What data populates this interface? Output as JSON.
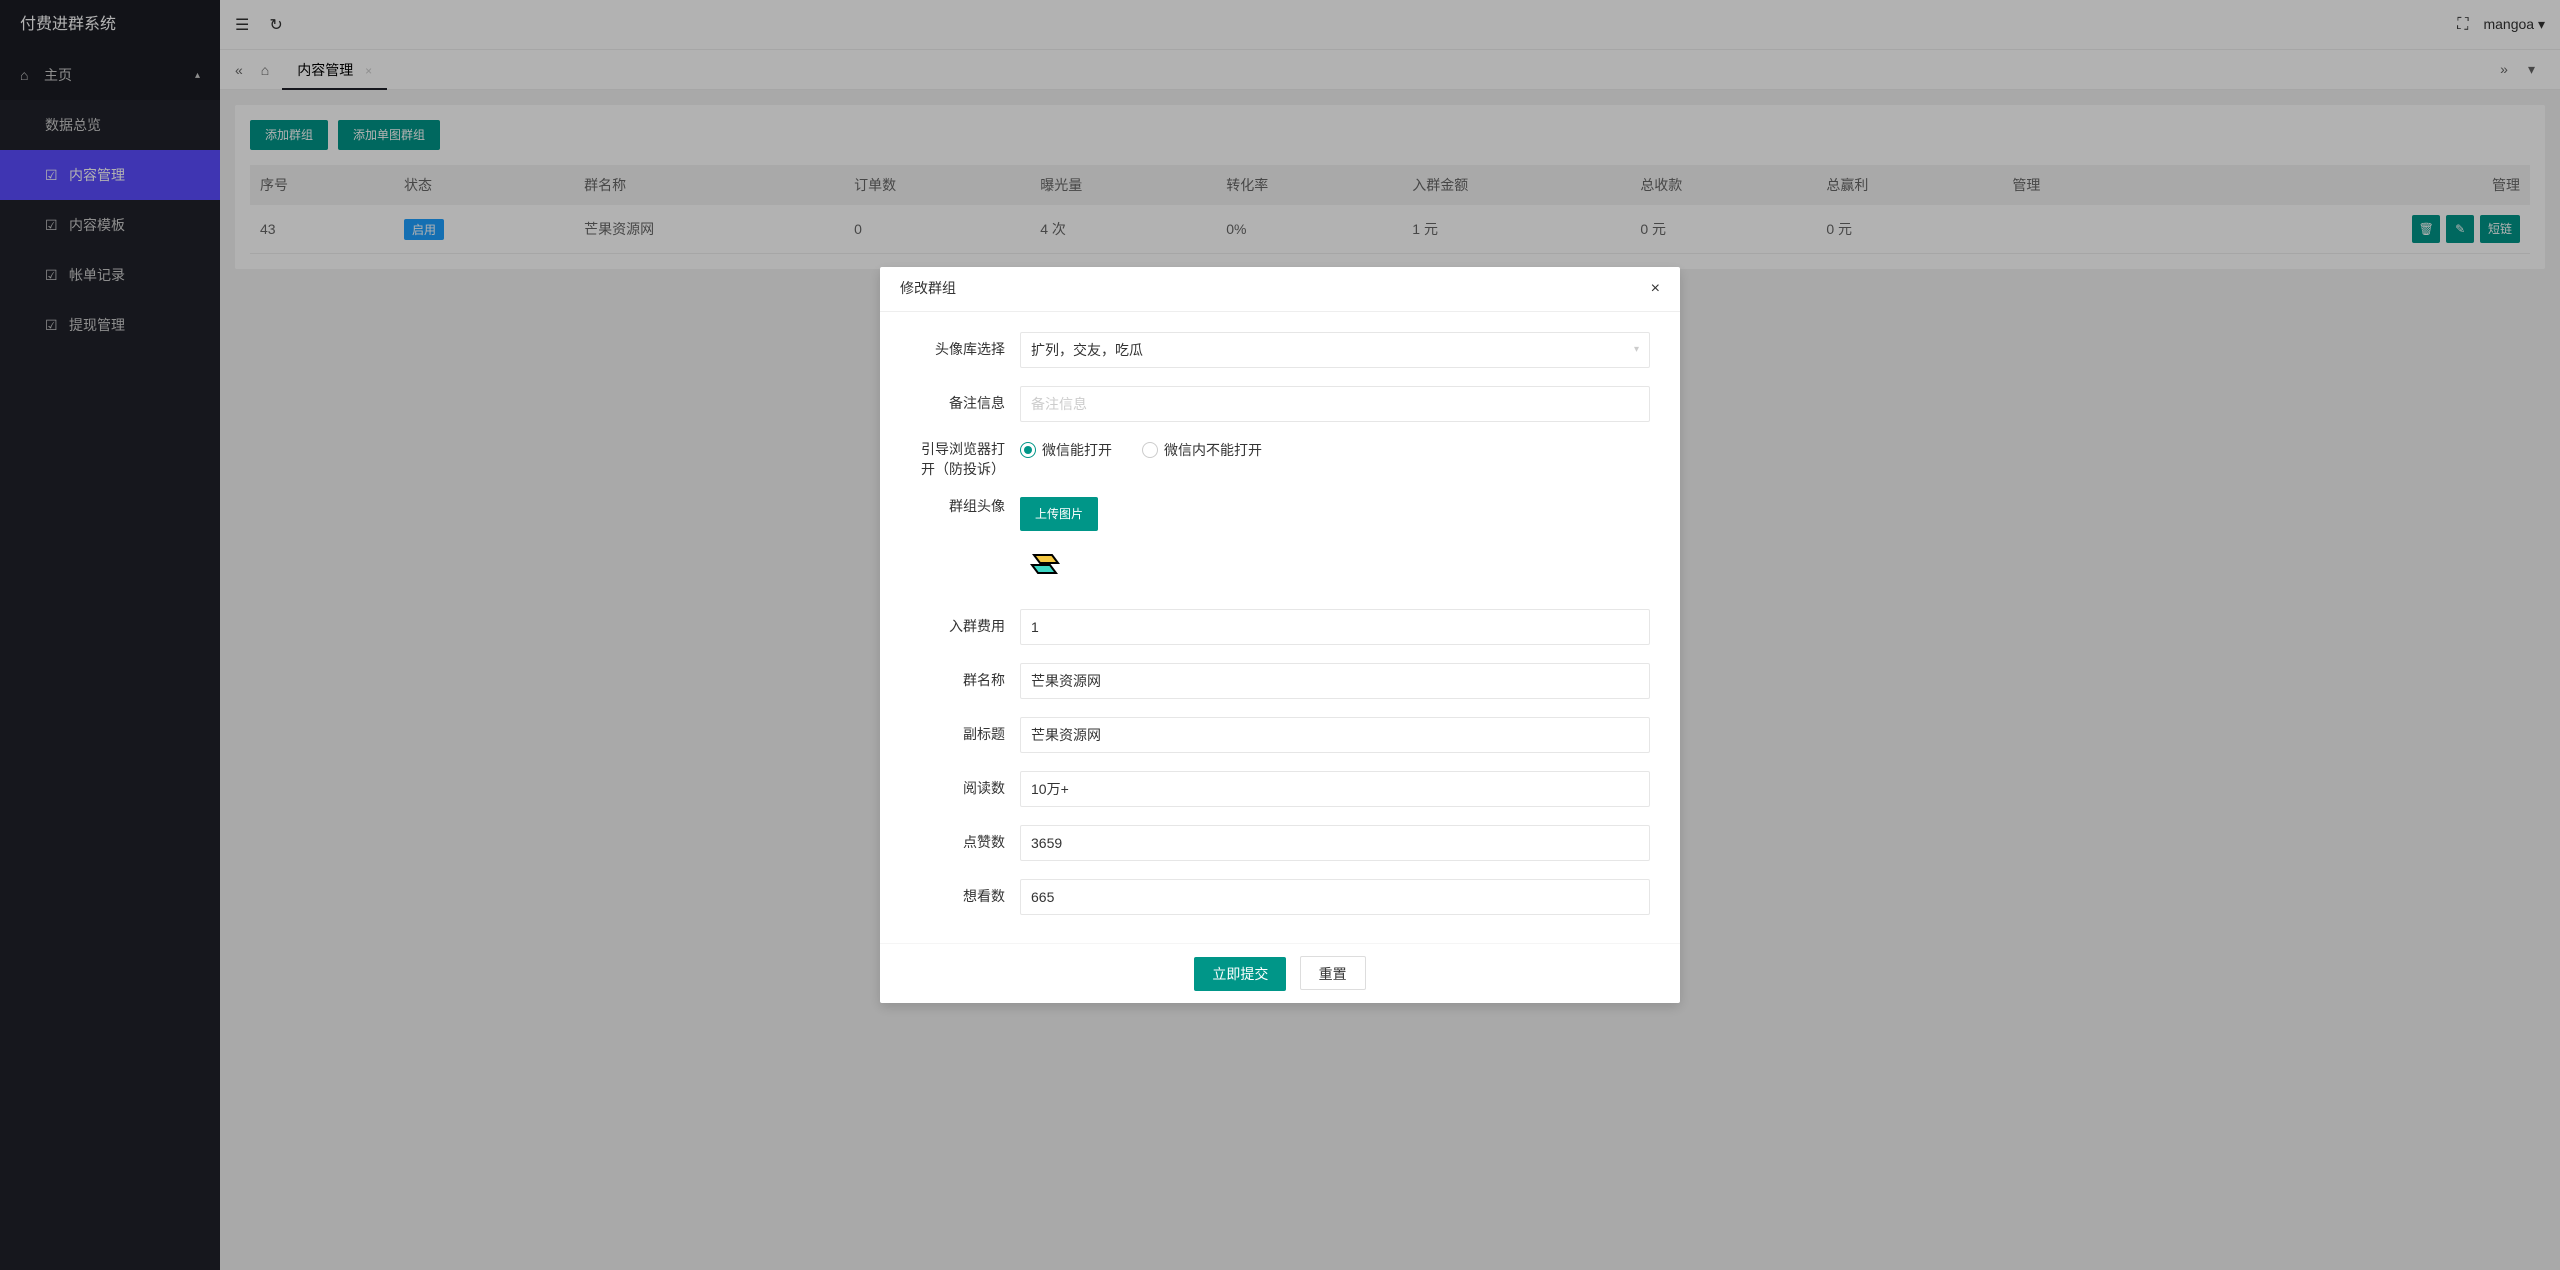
{
  "app": {
    "title": "付费进群系统"
  },
  "sidebar": {
    "main": {
      "label": "主页"
    },
    "items": [
      {
        "label": "数据总览"
      },
      {
        "label": "内容管理"
      },
      {
        "label": "内容模板"
      },
      {
        "label": "帐单记录"
      },
      {
        "label": "提现管理"
      }
    ]
  },
  "topbar": {
    "user": "mangoa"
  },
  "tabs": {
    "items": [
      {
        "label": "内容管理"
      }
    ]
  },
  "toolbar": {
    "add_group": "添加群组",
    "add_single": "添加单图群组"
  },
  "table": {
    "headers": {
      "seq": "序号",
      "status": "状态",
      "name": "群名称",
      "orders": "订单数",
      "exposure": "曝光量",
      "rate": "转化率",
      "amount": "入群金额",
      "total_rev": "总收款",
      "total_profit": "总赢利",
      "manage1": "管理",
      "manage2": "管理"
    },
    "rows": [
      {
        "seq": "43",
        "status": "启用",
        "name": "芒果资源网",
        "orders": "0",
        "exposure": "4 次",
        "rate": "0%",
        "amount": "1 元",
        "total_rev": "0 元",
        "total_profit": "0 元",
        "link_label": "短链"
      }
    ]
  },
  "modal": {
    "title": "修改群组",
    "labels": {
      "avatar_lib": "头像库选择",
      "remark": "备注信息",
      "browser": "引导浏览器打开（防投诉）",
      "group_avatar": "群组头像",
      "fee": "入群费用",
      "name": "群名称",
      "subtitle": "副标题",
      "reads": "阅读数",
      "likes": "点赞数",
      "wants": "想看数"
    },
    "values": {
      "avatar_lib": "扩列，交友，吃瓜",
      "remark_placeholder": "备注信息",
      "radio_open": "微信能打开",
      "radio_closed": "微信内不能打开",
      "upload": "上传图片",
      "fee": "1",
      "name": "芒果资源网",
      "subtitle": "芒果资源网",
      "reads": "10万+",
      "likes": "3659",
      "wants": "665"
    },
    "footer": {
      "submit": "立即提交",
      "reset": "重置"
    }
  }
}
